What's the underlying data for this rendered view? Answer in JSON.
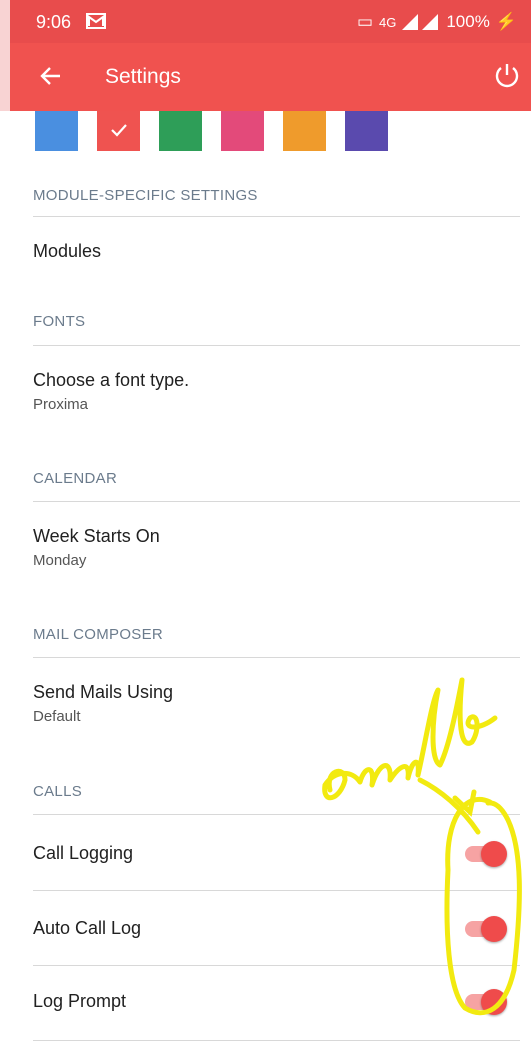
{
  "status_bar": {
    "time": "9:06",
    "network": "4G",
    "battery": "100%"
  },
  "app_bar": {
    "title": "Settings"
  },
  "theme_colors": [
    {
      "color": "#4a8fe0",
      "selected": false
    },
    {
      "color": "#ef5350",
      "selected": true
    },
    {
      "color": "#2e9e58",
      "selected": false
    },
    {
      "color": "#e34a7a",
      "selected": false
    },
    {
      "color": "#ef9b2c",
      "selected": false
    },
    {
      "color": "#5a4aae",
      "selected": false
    }
  ],
  "sections": {
    "module_specific": {
      "heading": "MODULE-SPECIFIC SETTINGS",
      "item": "Modules"
    },
    "fonts": {
      "heading": "FONTS",
      "title": "Choose a font type.",
      "value": "Proxima"
    },
    "calendar": {
      "heading": "CALENDAR",
      "title": "Week Starts On",
      "value": "Monday"
    },
    "mail_composer": {
      "heading": "MAIL COMPOSER",
      "title": "Send Mails Using",
      "value": "Default"
    },
    "calls": {
      "heading": "CALLS",
      "items": [
        {
          "label": "Call Logging",
          "enabled": true
        },
        {
          "label": "Auto Call Log",
          "enabled": true
        },
        {
          "label": "Log Prompt",
          "enabled": true
        }
      ]
    }
  },
  "annotation": {
    "text": "enable",
    "color": "#f2ea10"
  }
}
